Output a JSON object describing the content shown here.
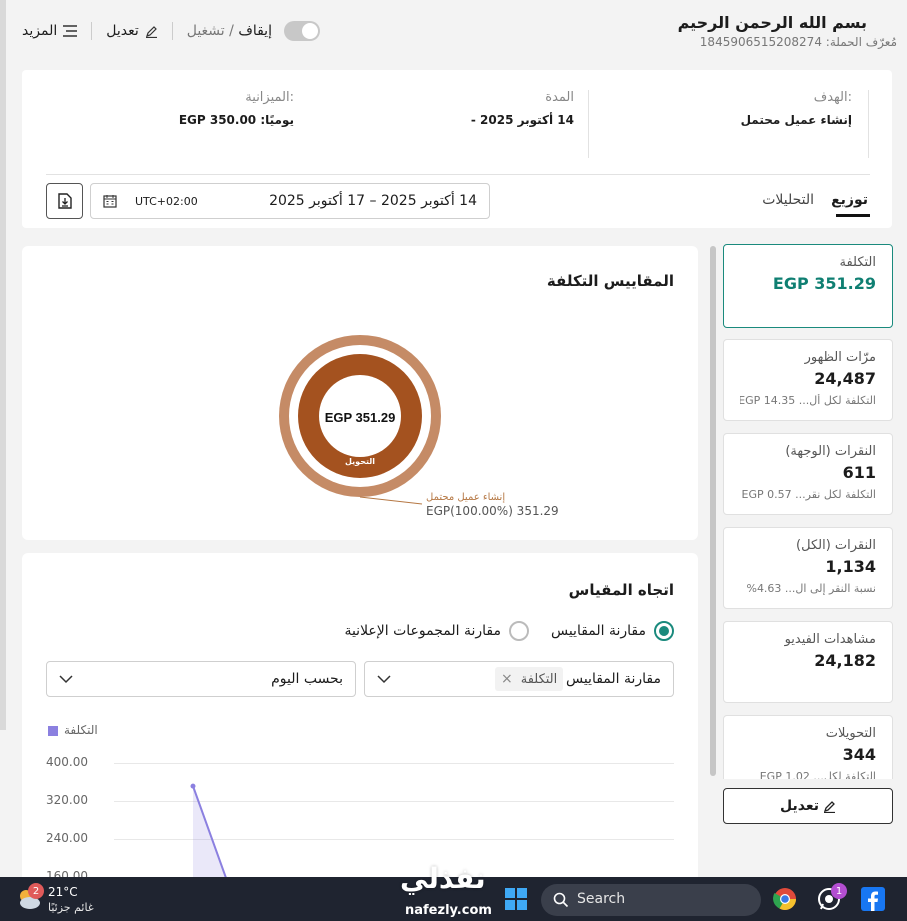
{
  "header": {
    "title": "بسم الله الرحمن الرحيم",
    "campaign_id_label": "مُعرّف الحملة:",
    "campaign_id": "1845906515208274",
    "run_label": "تشغيل",
    "slash": " / ",
    "pause_label": "إيقاف",
    "edit_label": "تعديل",
    "more_label": "المزيد"
  },
  "summary": {
    "goal_label": "الهدف:",
    "goal_value": "إنشاء عميل محتمل",
    "duration_label": "المدة",
    "duration_value": "14 أكتوبر 2025 -",
    "budget_label": "الميزانية:",
    "budget_value": "يوميًا: EGP 350.00",
    "tabs": [
      "توزيع",
      "التحليلات"
    ],
    "active_tab": "توزيع",
    "date_range": "14 أكتوبر 2025 – 17 أكتوبر 2025",
    "timezone": "UTC+02:00"
  },
  "metrics": [
    {
      "label": "التكلفة",
      "value": "EGP 351.29",
      "sub": ""
    },
    {
      "label": "مرّات الظهور",
      "value": "24,487",
      "sub": "التكلفة لكل أل... EGP 14.35"
    },
    {
      "label": "النقرات (الوجهة)",
      "value": "611",
      "sub": "التكلفة لكل نقر... EGP 0.57"
    },
    {
      "label": "النقرات (الكل)",
      "value": "1,134",
      "sub": "نسبة النقر إلى ال... 4.63%"
    },
    {
      "label": "مشاهدات الفيديو",
      "value": "24,182",
      "sub": ""
    },
    {
      "label": "التحويلات",
      "value": "344",
      "sub": "التكلفة لكل... EGP 1.02"
    }
  ],
  "edit_button": "تعديل",
  "cost_card": {
    "title": "المقاييس التكلفة",
    "center_value": "EGP 351.29",
    "ring_label": "التحويل",
    "legend_name": "إنشاء عميل محتمل",
    "legend_value": "EGP(100.00%) 351.29"
  },
  "trend_card": {
    "title": "اتجاه المقياس",
    "radio_metrics": "مقارنة المقاييس",
    "radio_adsets": "مقارنة المجموعات الإعلانية",
    "select_metric_label": "مقارنة المقاييس",
    "select_metric_chip": "التكلفة",
    "select_period": "بحسب اليوم",
    "legend": "التكلفة"
  },
  "chart_data": {
    "type": "line",
    "title": "",
    "xlabel": "",
    "ylabel": "",
    "y_ticks": [
      "400.00",
      "320.00",
      "240.00",
      "160.00"
    ],
    "ylim": [
      160,
      400
    ],
    "series": [
      {
        "name": "التكلفة",
        "values": [
          351.29,
          0
        ]
      }
    ],
    "color": "#8b80e0"
  },
  "taskbar": {
    "temp": "21°C",
    "weather": "غائم جزئيًا",
    "weather_badge": "2",
    "search_placeholder": "Search",
    "whatsapp_badge": "1"
  },
  "watermark": {
    "arabic": "نفذلي",
    "url": "nafezly.com"
  },
  "colors": {
    "accent": "#1a8a7d",
    "donut_outer": "#c58b66",
    "donut_inner": "#a4521f",
    "chart_line": "#8b80e0"
  }
}
